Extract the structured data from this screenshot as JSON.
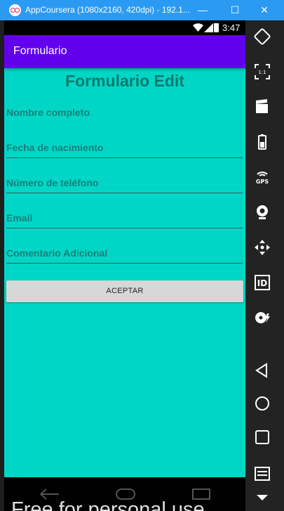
{
  "window": {
    "title": "AppCoursera (1080x2160, 420dpi) - 192.1...",
    "minimize_glyph": "—",
    "maximize_glyph": "☐",
    "close_glyph": "✕"
  },
  "statusbar": {
    "time": "3:47"
  },
  "appbar": {
    "title": "Formulario"
  },
  "form": {
    "heading": "Formulario Edit",
    "fields": [
      {
        "placeholder": "Nombre completo"
      },
      {
        "placeholder": "Fecha de nacimiento"
      },
      {
        "placeholder": "Número de teléfono"
      },
      {
        "placeholder": "Email"
      },
      {
        "placeholder": "Comentario Adicional"
      }
    ],
    "accept_label": "ACEPTAR"
  },
  "watermark": "Free for personal use",
  "toolbar": {
    "items": [
      "rotate-icon",
      "aspect-ratio-icon",
      "screen-record-icon",
      "battery-icon",
      "gps-icon",
      "webcam-icon",
      "dpad-icon",
      "identifier-icon",
      "media-disk-icon",
      "back-icon",
      "home-icon",
      "recent-apps-icon",
      "menu-icon",
      "more-down-icon"
    ],
    "gps_label": "GPS",
    "id_label": "ID",
    "ratio_label": "1:1"
  },
  "colors": {
    "titlebar": "#2b9af3",
    "appbar": "#6200ee",
    "background": "#00d6c5",
    "heading": "#0a7a6e",
    "button": "#d7d7d7"
  }
}
